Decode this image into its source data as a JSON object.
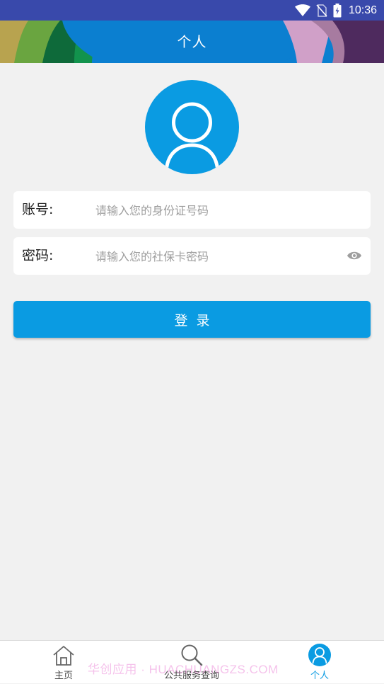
{
  "status_bar": {
    "time": "10:36"
  },
  "header": {
    "title": "个人"
  },
  "form": {
    "account_label": "账号:",
    "account_placeholder": "请输入您的身份证号码",
    "password_label": "密码:",
    "password_placeholder": "请输入您的社保卡密码",
    "login_label": "登录"
  },
  "bottom_nav": {
    "items": [
      {
        "label": "主页",
        "icon": "home-icon"
      },
      {
        "label": "公共服务查询",
        "icon": "search-icon"
      },
      {
        "label": "个人",
        "icon": "person-icon",
        "active": true
      }
    ]
  },
  "watermark": {
    "text": "华创应用 · HUACHUANGZS.COM"
  },
  "colors": {
    "accent": "#0a9be2",
    "status_bar": "#3949ab",
    "background": "#f1f1f1"
  }
}
